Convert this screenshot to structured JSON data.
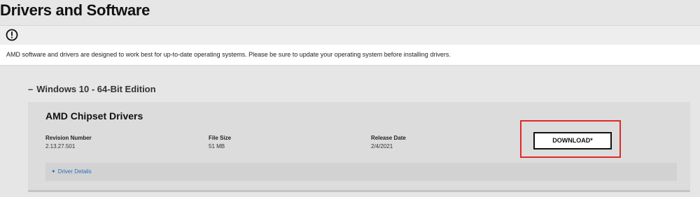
{
  "page": {
    "title": "Drivers and Software"
  },
  "notice": {
    "icon": "alert-circle-icon",
    "text": "AMD software and drivers are designed to work best for up-to-date operating systems. Please be sure to update your operating system before installing drivers."
  },
  "os_section": {
    "collapse_symbol": "–",
    "title": "Windows 10 - 64-Bit Edition"
  },
  "driver": {
    "title": "AMD Chipset Drivers",
    "revision_label": "Revision Number",
    "revision_value": "2.13.27.501",
    "size_label": "File Size",
    "size_value": "51 MB",
    "date_label": "Release Date",
    "date_value": "2/4/2021",
    "download_label": "DOWNLOAD*",
    "details_symbol": "✦",
    "details_label": "Driver Details"
  },
  "colors": {
    "highlight": "#e02828",
    "link": "#2a6ebb"
  }
}
